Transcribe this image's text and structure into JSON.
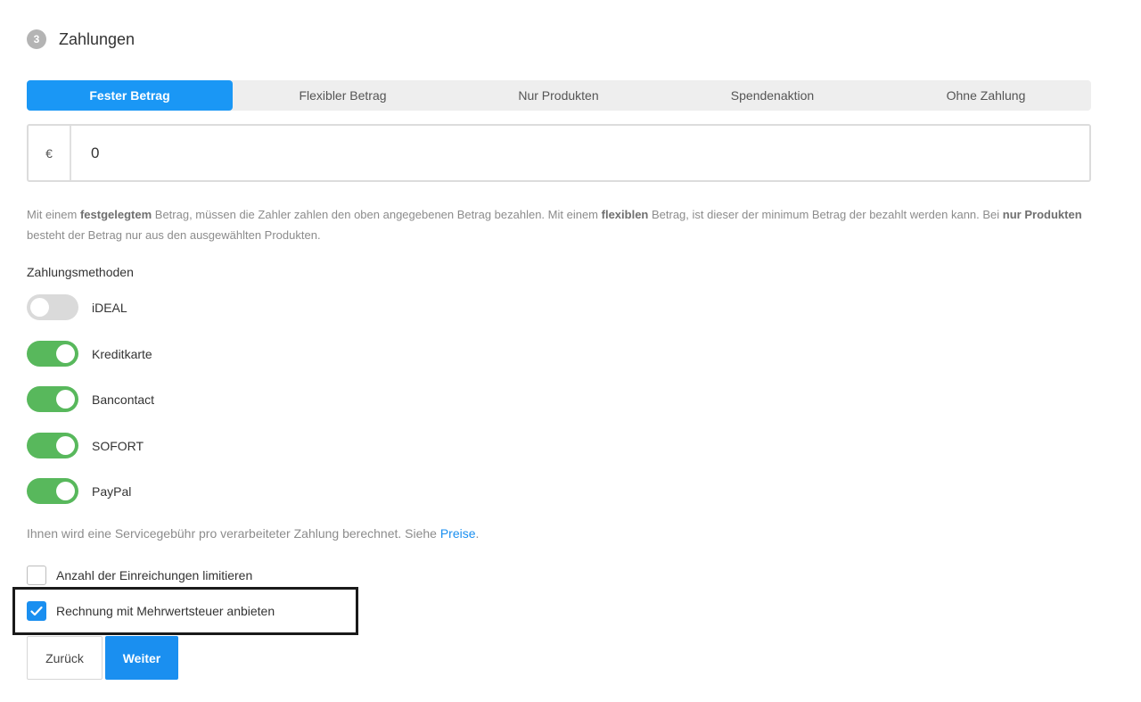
{
  "section": {
    "step": "3",
    "title": "Zahlungen"
  },
  "tabs": [
    {
      "label": "Fester Betrag",
      "active": true
    },
    {
      "label": "Flexibler Betrag",
      "active": false
    },
    {
      "label": "Nur Produkten",
      "active": false
    },
    {
      "label": "Spendenaktion",
      "active": false
    },
    {
      "label": "Ohne Zahlung",
      "active": false
    }
  ],
  "amount": {
    "currency": "€",
    "value": "0"
  },
  "help": {
    "p1": "Mit einem ",
    "b1": "festgelegtem",
    "p2": " Betrag, müssen die Zahler zahlen den oben angegebenen Betrag bezahlen. Mit einem ",
    "b2": "flexiblen",
    "p3": " Betrag, ist dieser der minimum Betrag der bezahlt werden kann. Bei ",
    "b3": "nur Produkten",
    "p4": " besteht der Betrag nur aus den ausgewählten Produkten."
  },
  "payment_methods": {
    "label": "Zahlungsmethoden",
    "items": [
      {
        "name": "iDEAL",
        "enabled": false
      },
      {
        "name": "Kreditkarte",
        "enabled": true
      },
      {
        "name": "Bancontact",
        "enabled": true
      },
      {
        "name": "SOFORT",
        "enabled": true
      },
      {
        "name": "PayPal",
        "enabled": true
      }
    ]
  },
  "fee": {
    "text": "Ihnen wird eine Servicegebühr pro verarbeiteter Zahlung berechnet. Siehe ",
    "link": "Preise",
    "suffix": "."
  },
  "options": [
    {
      "label": "Anzahl der Einreichungen limitieren",
      "checked": false
    },
    {
      "label": "Rechnung mit Mehrwertsteuer anbieten",
      "checked": true
    }
  ],
  "buttons": {
    "back": "Zurück",
    "next": "Weiter"
  },
  "colors": {
    "accent": "#1a8ff0",
    "toggle_on": "#58b85c",
    "toggle_off": "#dadada"
  }
}
